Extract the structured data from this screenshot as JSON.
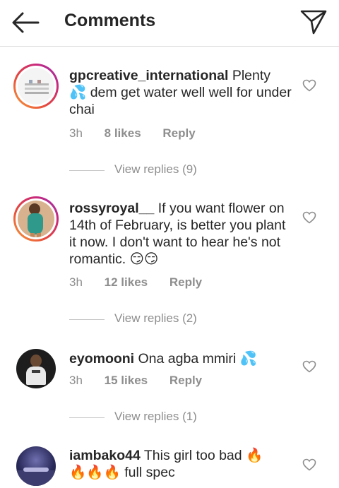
{
  "header": {
    "title": "Comments",
    "back_icon": "arrow-left-icon",
    "send_icon": "paper-plane-icon"
  },
  "comments": [
    {
      "username": "gpcreative_international",
      "text_before": " Plenty",
      "emoji_1": "💦",
      "text_after": " dem get water well well for under chai",
      "time": "3h",
      "likes": "8 likes",
      "reply": "Reply",
      "view_replies": "View replies (9)"
    },
    {
      "username": "rossyroyal__",
      "text": " If you want flower on 14th of February, is better you plant it now. I don't want to hear he's not romantic. ",
      "emoji": "😏😏",
      "time": "3h",
      "likes": "12 likes",
      "reply": "Reply",
      "view_replies": "View replies (2)"
    },
    {
      "username": "eyomooni",
      "text": " Ona agba mmiri ",
      "emoji": "💦",
      "time": "3h",
      "likes": "15 likes",
      "reply": "Reply",
      "view_replies": "View replies (1)"
    },
    {
      "username": "iambako44",
      "text": " This girl too bad ",
      "emoji_1": "🔥",
      "emoji_2": "🔥🔥🔥",
      "text_after": " full spec"
    }
  ],
  "colors": {
    "text": "#262626",
    "secondary": "#8e8e8e",
    "divider": "#dbdbdb"
  }
}
